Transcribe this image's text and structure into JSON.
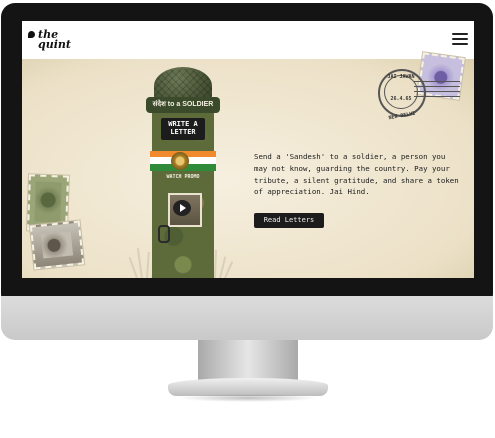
{
  "header": {
    "logo_line1": "the",
    "logo_line2": "quint"
  },
  "postbox": {
    "top_label": "संदेश to a SOLDIER",
    "slot_line1": "WRITE A",
    "slot_line2": "LETTER",
    "promo_label": "WATCH PROMO"
  },
  "postmark": {
    "top": "JAI JAWAN",
    "date": "26.4.65",
    "bottom": "NEW DELHI"
  },
  "main": {
    "message": "Send a 'Sandesh' to a soldier, a person you may not know, guarding the country. Pay your tribute, a silent gratitude, and share a token of appreciation. Jai Hind.",
    "button_label": "Read Letters"
  },
  "icons": [
    "quint-logo-icon",
    "hamburger-menu-icon",
    "play-icon",
    "postbox-illustration",
    "stamp-icon"
  ],
  "colors": {
    "background_paper": "#f3ecdd",
    "button": "#1c1c1c",
    "olive": "#5d6b3b",
    "saffron": "#f08a2c",
    "india_green": "#2f8b3a"
  }
}
